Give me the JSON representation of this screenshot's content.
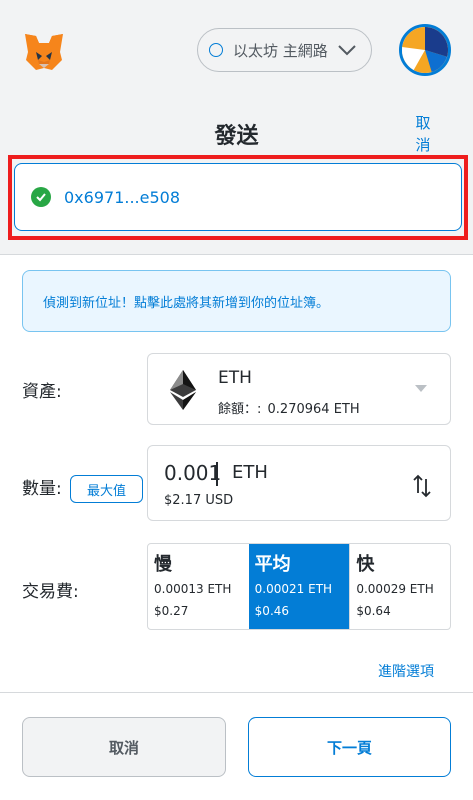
{
  "header": {
    "network_label": "以太坊 主網路",
    "title": "發送",
    "cancel_link": "取消"
  },
  "recipient": {
    "address": "0x6971...e508",
    "status": "verified"
  },
  "notice": {
    "text": "偵測到新位址！點擊此處將其新增到你的位址簿。"
  },
  "form": {
    "asset_label": "資產:",
    "amount_label": "數量:",
    "fee_label": "交易費:",
    "max_button": "最大值"
  },
  "asset": {
    "symbol": "ETH",
    "balance_label": "餘額：:",
    "balance_value": "0.270964 ETH"
  },
  "amount": {
    "value": "0.001",
    "unit": "ETH",
    "fiat": "$2.17 USD"
  },
  "fees": [
    {
      "name": "慢",
      "eth": "0.00013 ETH",
      "usd": "$0.27",
      "selected": false
    },
    {
      "name": "平均",
      "eth": "0.00021 ETH",
      "usd": "$0.46",
      "selected": true
    },
    {
      "name": "快",
      "eth": "0.00029 ETH",
      "usd": "$0.64",
      "selected": false
    }
  ],
  "advanced_link": "進階選項",
  "footer": {
    "cancel": "取消",
    "next": "下一頁"
  },
  "colors": {
    "accent": "#037dd6",
    "highlight": "#ee1d1d",
    "success": "#28a745"
  },
  "icons": [
    "metamask-fox-icon",
    "network-status-icon",
    "chevron-down-icon",
    "account-avatar-icon",
    "check-circle-icon",
    "eth-logo-icon",
    "dropdown-caret-icon",
    "swap-icon"
  ]
}
